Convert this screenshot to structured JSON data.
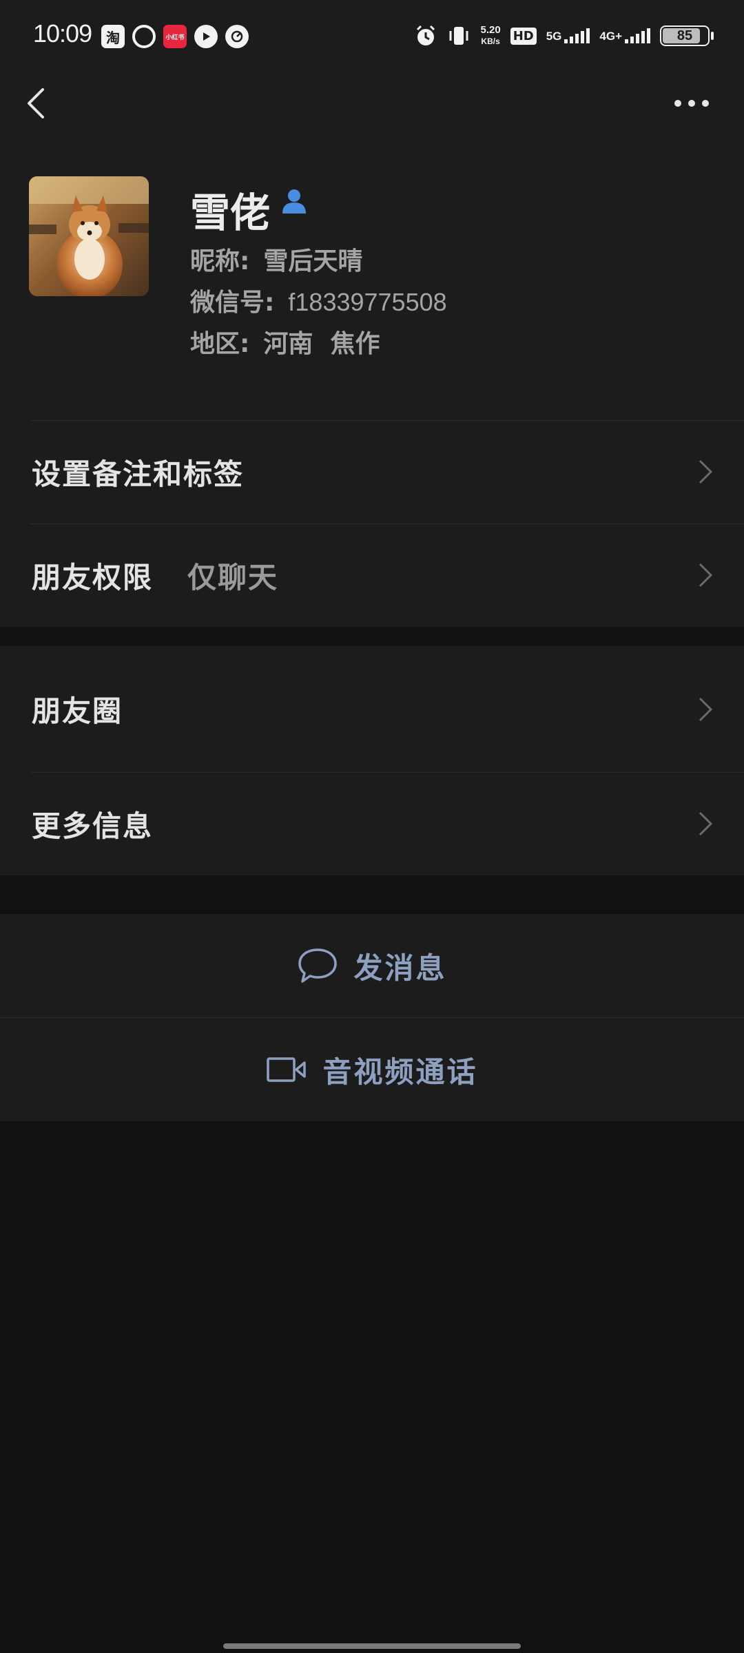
{
  "status_bar": {
    "time": "10:09",
    "app_icons": [
      {
        "icon": "taobao-icon",
        "text": "淘"
      },
      {
        "icon": "search-app-icon",
        "text": "Q"
      },
      {
        "icon": "xiaohongshu-icon",
        "text": "小红书"
      },
      {
        "icon": "video-app-icon",
        "text": ""
      },
      {
        "icon": "speed-app-icon",
        "text": ""
      }
    ],
    "net_speed_value": "5.20",
    "net_speed_unit": "KB/s",
    "hd_label": "HD",
    "sim1_label": "5G",
    "sim2_label": "4G+",
    "battery_level": "85"
  },
  "nav": {
    "back_icon": "chevron-left-icon",
    "more_icon": "more-dots-icon"
  },
  "profile": {
    "name": "雪佬",
    "nickname_label": "昵称:",
    "nickname": "雪后天晴",
    "wechat_id_label": "微信号:",
    "wechat_id": "f18339775508",
    "region_label": "地区:",
    "region": "河南  焦作"
  },
  "settings": {
    "remark_label": "设置备注和标签",
    "permission_label": "朋友权限",
    "permission_value": "仅聊天",
    "moments_label": "朋友圈",
    "more_info_label": "更多信息"
  },
  "actions": {
    "message_label": "发消息",
    "call_label": "音视频通话"
  },
  "colors": {
    "background": "#111111",
    "card": "#1c1c1c",
    "action_text": "#8ea0bf",
    "gender_icon": "#4a8de0"
  }
}
